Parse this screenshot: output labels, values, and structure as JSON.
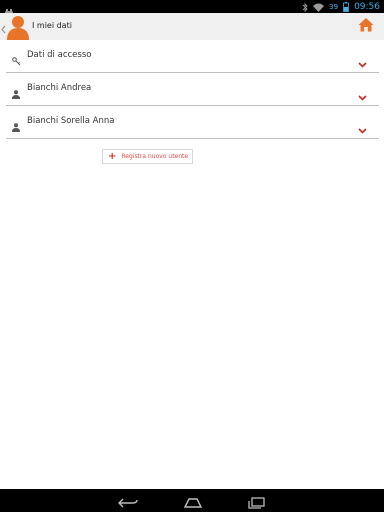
{
  "status_bar": {
    "battery_level": "39",
    "time": "09:56"
  },
  "action_bar": {
    "title": "I miei dati"
  },
  "list": {
    "items": [
      {
        "label": "Dati di accesso",
        "icon": "key-icon"
      },
      {
        "label": "Bianchi Andrea",
        "icon": "person-icon"
      },
      {
        "label": "Bianchi Sorella Anna",
        "icon": "person-icon"
      }
    ]
  },
  "register_button": {
    "label": "Registra nuovo utente"
  },
  "colors": {
    "accent": "#e8742a",
    "chevron": "#cc2a1f",
    "status_time": "#33b5e5"
  }
}
